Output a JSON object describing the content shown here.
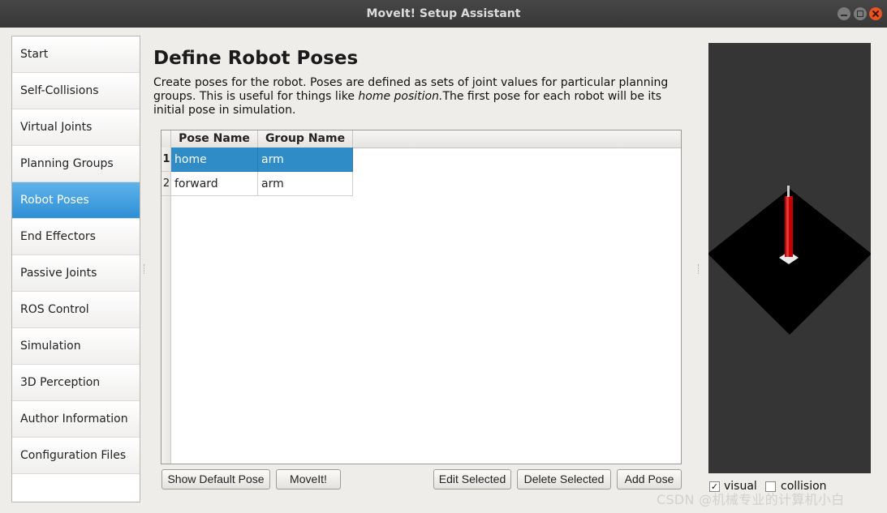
{
  "window": {
    "title": "MoveIt! Setup Assistant"
  },
  "nav": {
    "items": [
      {
        "label": "Start"
      },
      {
        "label": "Self-Collisions"
      },
      {
        "label": "Virtual Joints"
      },
      {
        "label": "Planning Groups"
      },
      {
        "label": "Robot Poses"
      },
      {
        "label": "End Effectors"
      },
      {
        "label": "Passive Joints"
      },
      {
        "label": "ROS Control"
      },
      {
        "label": "Simulation"
      },
      {
        "label": "3D Perception"
      },
      {
        "label": "Author Information"
      },
      {
        "label": "Configuration Files"
      }
    ],
    "selected": "Robot Poses"
  },
  "main": {
    "title": "Define Robot Poses",
    "desc_part1": "Create poses for the robot. Poses are defined as sets of joint values for particular planning groups. This is useful for things like ",
    "desc_em": "home position.",
    "desc_part2": "The first pose for each robot will be its initial pose in simulation."
  },
  "table": {
    "headers": [
      "Pose Name",
      "Group Name"
    ],
    "rows": [
      {
        "num": "1",
        "pose": "home",
        "group": "arm",
        "selected": true
      },
      {
        "num": "2",
        "pose": "forward",
        "group": "arm",
        "selected": false
      }
    ]
  },
  "buttons": {
    "show_default_pose": "Show Default Pose",
    "moveit": "MoveIt!",
    "edit_selected": "Edit Selected",
    "delete_selected": "Delete Selected",
    "add_pose": "Add Pose"
  },
  "viewer": {
    "visual_label": "visual",
    "visual_checked": true,
    "collision_label": "collision",
    "collision_checked": false,
    "background_color": "#353535",
    "ground_color": "#000000",
    "robot_color": "#c40000"
  },
  "watermark": "CSDN @机械专业的计算机小白"
}
